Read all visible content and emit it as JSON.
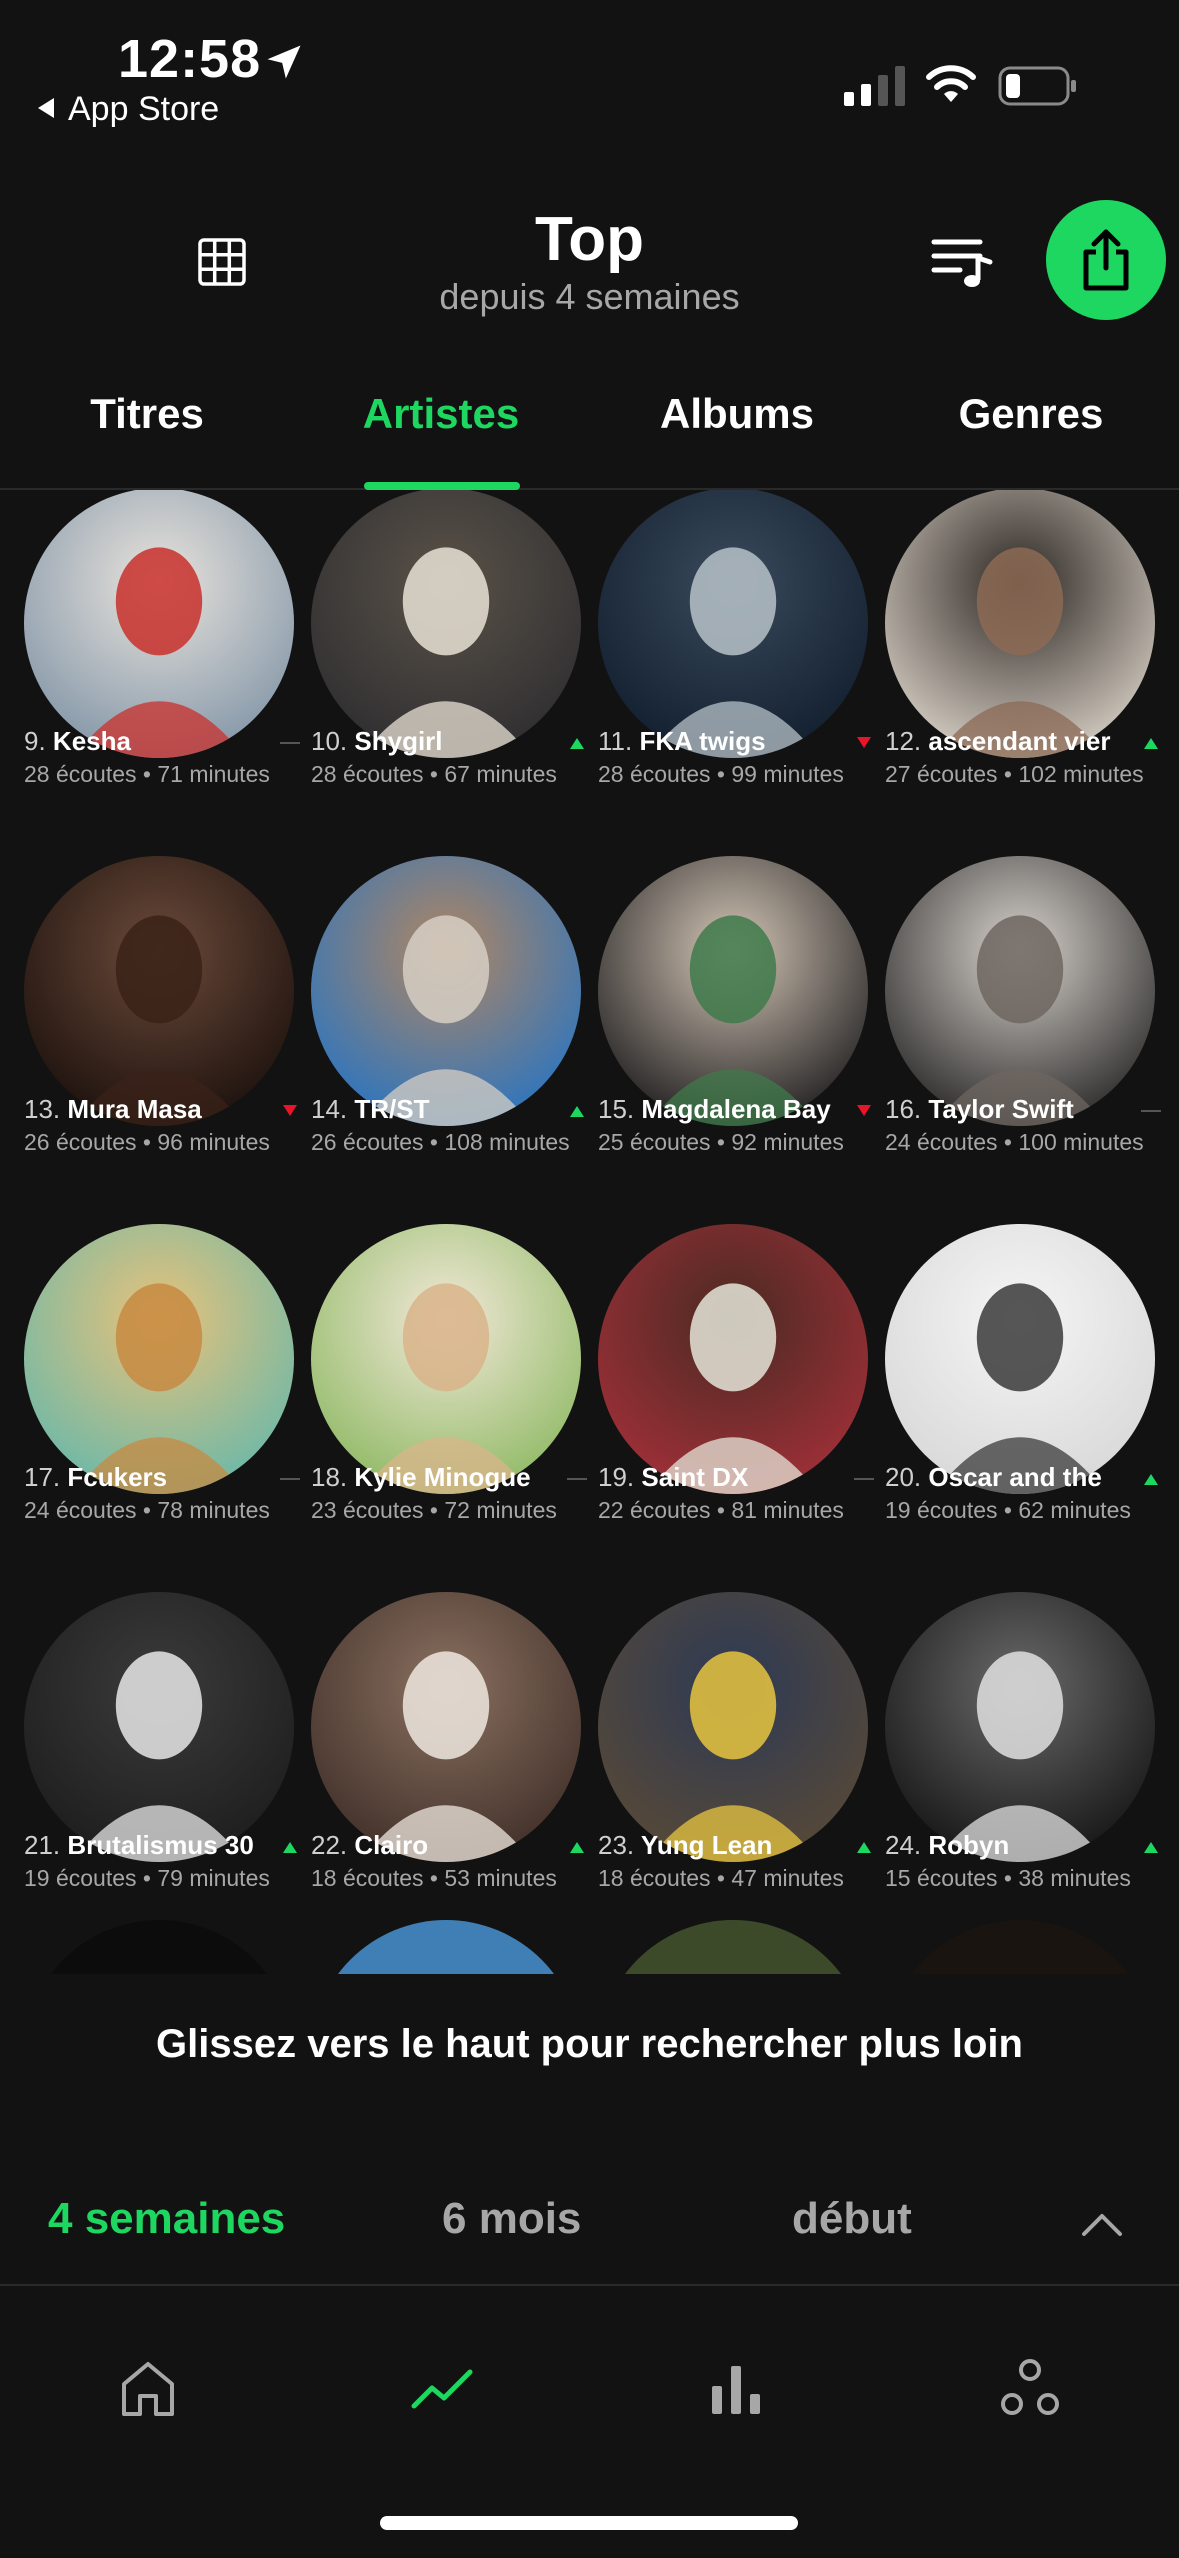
{
  "status_bar": {
    "time": "12:58",
    "back_label": "App Store"
  },
  "header": {
    "title": "Top",
    "subtitle": "depuis 4 semaines"
  },
  "tabs": [
    {
      "label": "Titres",
      "active": false
    },
    {
      "label": "Artistes",
      "active": true
    },
    {
      "label": "Albums",
      "active": false
    },
    {
      "label": "Genres",
      "active": false
    }
  ],
  "artists": [
    {
      "rank": "9.",
      "name": "Kesha",
      "stats": "28 écoutes • 71 minutes",
      "trend": "same"
    },
    {
      "rank": "10.",
      "name": "Shygirl",
      "stats": "28 écoutes • 67 minutes",
      "trend": "up"
    },
    {
      "rank": "11.",
      "name": "FKA twigs",
      "stats": "28 écoutes • 99 minutes",
      "trend": "down"
    },
    {
      "rank": "12.",
      "name": "ascendant vier",
      "stats": "27 écoutes • 102 minutes",
      "trend": "up"
    },
    {
      "rank": "13.",
      "name": "Mura Masa",
      "stats": "26 écoutes • 96 minutes",
      "trend": "down"
    },
    {
      "rank": "14.",
      "name": "TR/ST",
      "stats": "26 écoutes • 108 minutes",
      "trend": "up"
    },
    {
      "rank": "15.",
      "name": "Magdalena Bay",
      "stats": "25 écoutes • 92 minutes",
      "trend": "down"
    },
    {
      "rank": "16.",
      "name": "Taylor Swift",
      "stats": "24 écoutes • 100 minutes",
      "trend": "same"
    },
    {
      "rank": "17.",
      "name": "Fcukers",
      "stats": "24 écoutes • 78 minutes",
      "trend": "same"
    },
    {
      "rank": "18.",
      "name": "Kylie Minogue",
      "stats": "23 écoutes • 72 minutes",
      "trend": "same"
    },
    {
      "rank": "19.",
      "name": "Saint DX",
      "stats": "22 écoutes • 81 minutes",
      "trend": "same"
    },
    {
      "rank": "20.",
      "name": "Oscar and the",
      "stats": "19 écoutes • 62 minutes",
      "trend": "up"
    },
    {
      "rank": "21.",
      "name": "Brutalismus 30",
      "stats": "19 écoutes • 79 minutes",
      "trend": "up"
    },
    {
      "rank": "22.",
      "name": "Clairo",
      "stats": "18 écoutes • 53 minutes",
      "trend": "up"
    },
    {
      "rank": "23.",
      "name": "Yung Lean",
      "stats": "18 écoutes • 47 minutes",
      "trend": "up"
    },
    {
      "rank": "24.",
      "name": "Robyn",
      "stats": "15 écoutes • 38 minutes",
      "trend": "up"
    }
  ],
  "swipe_hint": "Glissez vers le haut pour rechercher plus loin",
  "ranges": [
    {
      "label": "4 semaines",
      "active": true
    },
    {
      "label": "6 mois",
      "active": false
    },
    {
      "label": "début",
      "active": false
    }
  ],
  "colors": {
    "accent": "#1ed760",
    "trend_up": "#1ed760",
    "trend_down": "#e91429",
    "trend_same": "#555555",
    "background": "#121212"
  }
}
